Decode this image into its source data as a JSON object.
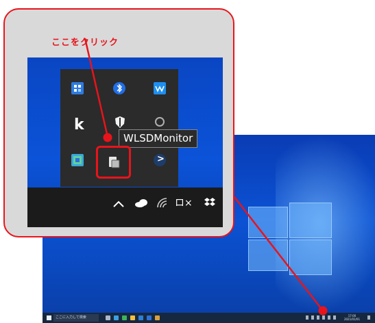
{
  "callout": {
    "label": "ここをクリック",
    "tooltip": "WLSDMonitor",
    "k_letter": "k",
    "arrow_glyph": ">",
    "tray_chevron": "^",
    "volume_mute": "ロ×"
  },
  "taskbar": {
    "search_placeholder": "ここに入力して検索",
    "clock_time": "17:00",
    "clock_date": "2021/01/01"
  },
  "colors": {
    "accent": "#e8141b",
    "desktop_blue": "#0b52d4",
    "tray_bg": "#2b2b2b",
    "taskbar_bg": "#1b1b1b"
  },
  "icons": [
    "winsdk-icon",
    "bluetooth-icon",
    "monitor-wave-icon",
    "k-app-icon",
    "shield-icon",
    "copilot-icon",
    "network-map-icon",
    "wlsd-monitor-icon",
    "chevron-app-icon",
    "show-hidden-icon",
    "onedrive-cloud-icon",
    "wifi-icon",
    "volume-mute-icon",
    "dropbox-icon"
  ]
}
